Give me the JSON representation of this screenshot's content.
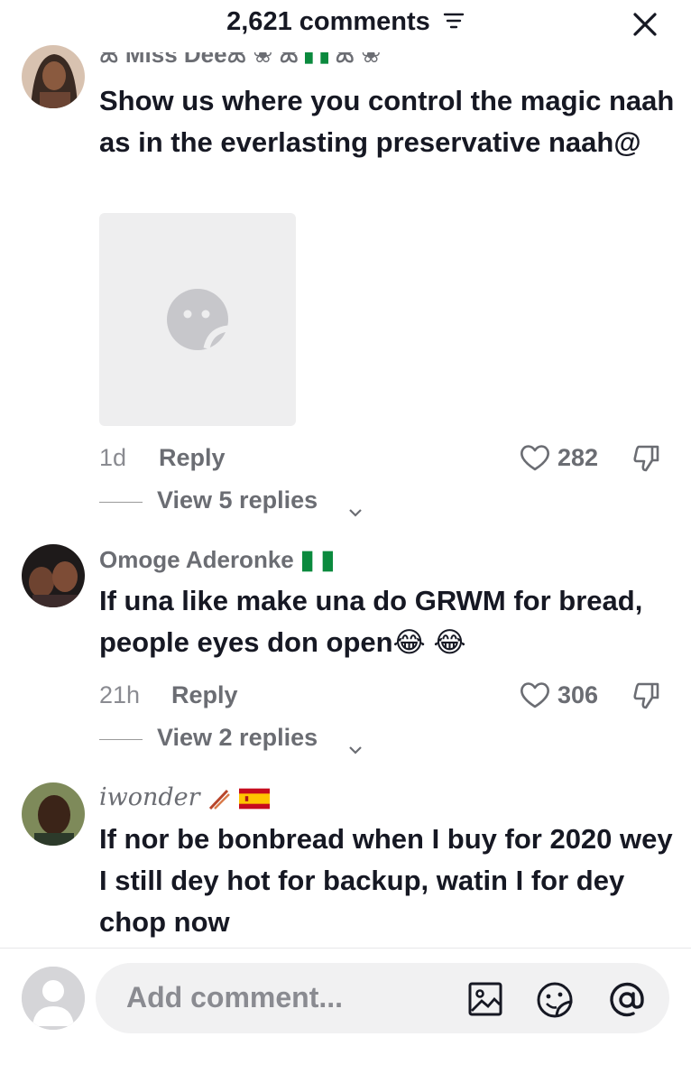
{
  "header": {
    "title": "2,621 comments"
  },
  "comments": [
    {
      "username": "Miss Dee",
      "text": "Show us where you control the magic naah as in the everlasting preservative naah@",
      "time": "1d",
      "reply_label": "Reply",
      "likes": "282",
      "view_replies": "View 5 replies"
    },
    {
      "username": "Omoge Aderonke",
      "text": "If una like make una do GRWM for bread, people eyes don open😂 😂",
      "time": "21h",
      "reply_label": "Reply",
      "likes": "306",
      "view_replies": "View 2 replies"
    },
    {
      "username": "iwonder",
      "text": "If nor be bonbread when I buy for 2020 wey I still dey hot for backup, watin I for dey chop now"
    }
  ],
  "composer": {
    "placeholder": "Add comment..."
  },
  "icons": [
    "filter-icon",
    "close-icon",
    "broken-image-icon",
    "heart-icon",
    "dislike-icon",
    "chevron-down-icon",
    "image-icon",
    "sticker-icon",
    "mention-icon"
  ],
  "colors": {
    "text": "#161823",
    "muted": "#6b6d73",
    "pill": "#f1f1f2"
  }
}
